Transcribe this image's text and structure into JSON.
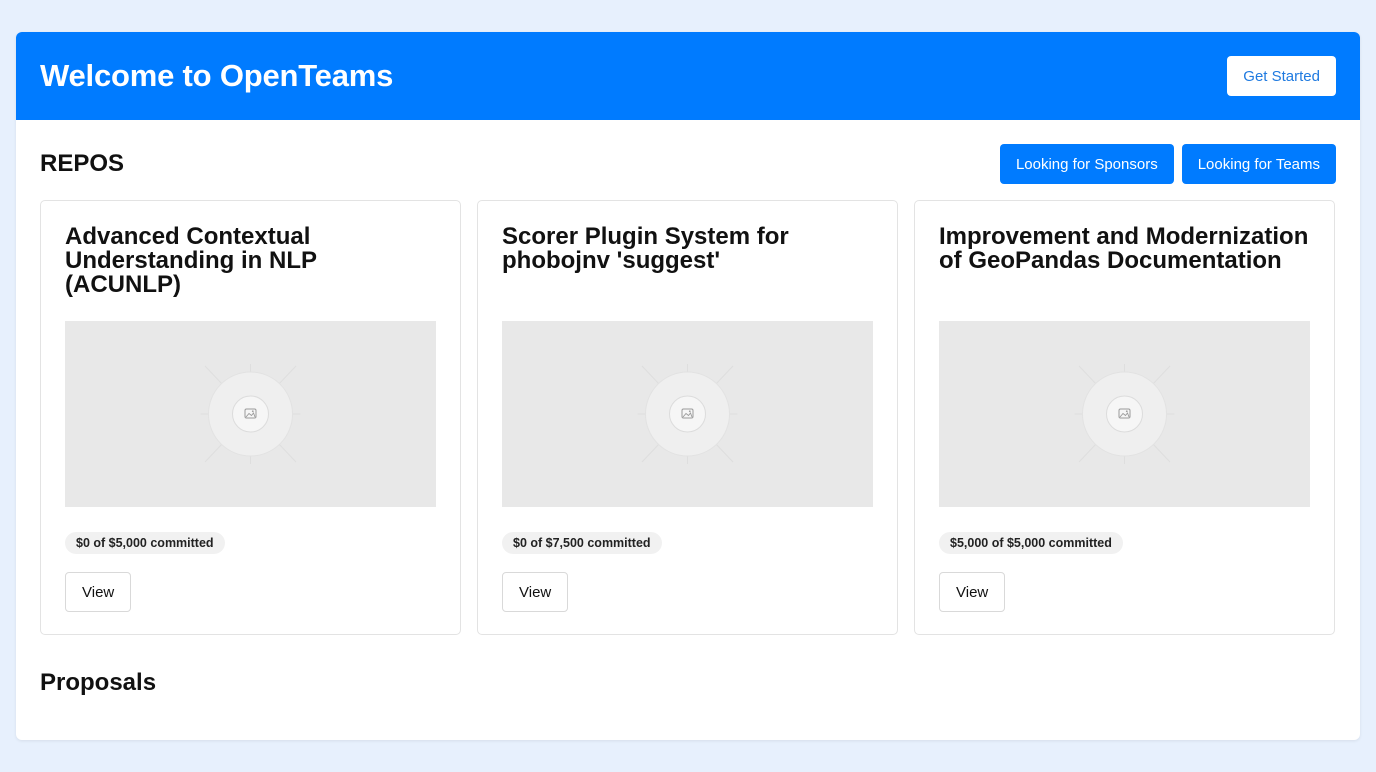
{
  "header": {
    "title": "Welcome to OpenTeams",
    "cta_label": "Get Started"
  },
  "repos": {
    "heading": "REPOS",
    "filters": [
      "Looking for Sponsors",
      "Looking for Teams"
    ],
    "cards": [
      {
        "title": "Advanced Contextual Understanding in NLP (ACUNLP)",
        "image_icon": "image-placeholder-icon",
        "commitment": "$0 of $5,000 committed",
        "action_label": "View"
      },
      {
        "title": "Scorer Plugin System for phobojnv 'suggest'",
        "image_icon": "image-placeholder-icon",
        "commitment": "$0 of $7,500 committed",
        "action_label": "View"
      },
      {
        "title": "Improvement and Modernization of GeoPandas Documentation",
        "image_icon": "image-placeholder-icon",
        "commitment": "$5,000 of $5,000 committed",
        "action_label": "View"
      }
    ]
  },
  "proposals": {
    "heading": "Proposals"
  },
  "colors": {
    "background": "#e7f0fd",
    "brand_blue": "#007bff",
    "surface": "#ffffff",
    "placeholder": "#e8e8e8"
  }
}
